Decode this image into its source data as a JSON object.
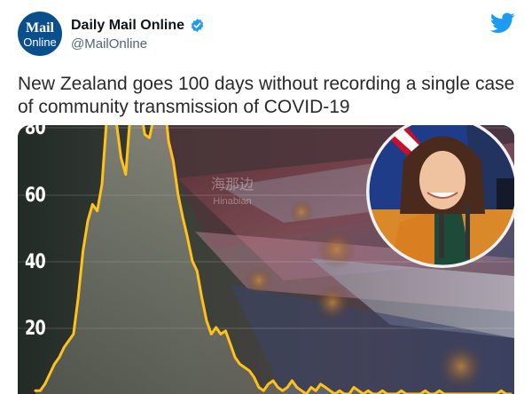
{
  "account": {
    "avatar_line1": "Mail",
    "avatar_line2": "Online",
    "name": "Daily Mail Online",
    "handle": "@MailOnline"
  },
  "icons": {
    "verified": "verified-badge-icon",
    "logo": "twitter-bird-icon"
  },
  "colors": {
    "verified_blue": "#1d9bf0",
    "twitter_blue": "#1d9bf0",
    "chart_line": "#ffc21a",
    "avatar_bg": "#0a4f8c"
  },
  "tweet": {
    "text": "New Zealand goes 100 days without recording a single case of community transmission of COVID-19"
  },
  "media": {
    "watermark_line1": "海那边",
    "watermark_line2": "Hinabian"
  },
  "chart_data": {
    "type": "line",
    "title": "",
    "xlabel": "",
    "ylabel": "",
    "ylim": [
      0,
      80
    ],
    "yticks": [
      "80",
      "60",
      "40",
      "20"
    ],
    "grid": true,
    "series": [
      {
        "values": [
          1,
          1,
          3,
          6,
          9,
          11,
          14,
          16,
          18,
          29,
          43,
          52,
          57,
          55,
          63,
          83,
          90,
          82,
          71,
          66,
          85,
          93,
          87,
          78,
          77,
          84,
          94,
          90,
          76,
          70,
          60,
          53,
          47,
          40,
          37,
          29,
          22,
          18,
          20,
          18,
          19,
          15,
          11,
          9,
          8,
          7,
          5,
          2,
          1,
          3,
          4,
          2,
          1,
          2,
          4,
          2,
          1,
          0,
          2,
          1,
          3,
          2,
          1,
          0,
          1,
          0,
          0,
          2,
          1,
          0,
          1,
          0,
          0,
          1,
          0,
          0,
          0,
          1,
          0,
          0,
          0,
          0,
          1,
          0,
          0,
          1,
          0,
          0,
          0,
          0,
          0,
          0,
          0,
          0,
          0,
          0,
          0,
          0,
          1,
          0,
          0
        ]
      }
    ]
  }
}
